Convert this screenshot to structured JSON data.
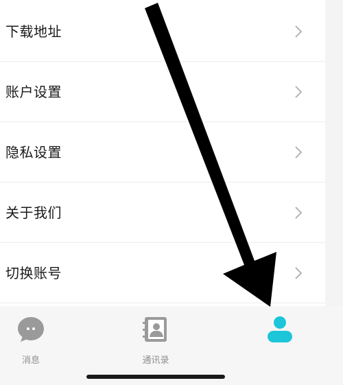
{
  "settings": {
    "items": [
      {
        "label": "下载地址"
      },
      {
        "label": "账户设置"
      },
      {
        "label": "隐私设置"
      },
      {
        "label": "关于我们"
      },
      {
        "label": "切换账号"
      }
    ]
  },
  "tab_bar": {
    "tabs": [
      {
        "label": "消息",
        "icon": "chat-bubble-icon"
      },
      {
        "label": "通讯录",
        "icon": "contacts-icon"
      },
      {
        "label": "",
        "icon": "profile-icon",
        "active": true
      }
    ]
  },
  "colors": {
    "accent": "#1cc6d8",
    "inactive_icon": "#9a9a9a",
    "annotation_arrow": "#000000"
  }
}
